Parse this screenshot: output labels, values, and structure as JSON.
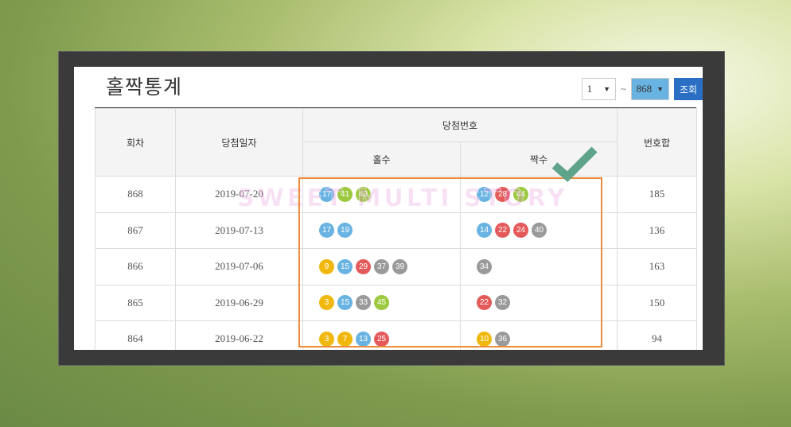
{
  "title": "홀짝통계",
  "controls": {
    "from_value": "1",
    "to_value": "868",
    "tilde": "~",
    "search_label": "조회"
  },
  "headers": {
    "round": "회차",
    "date": "당첨일자",
    "numbers": "당첨번호",
    "odd": "홀수",
    "even": "짝수",
    "sum": "번호합"
  },
  "watermark": "SWEET MULTI STORY",
  "colors": {
    "yellow": "#f0b80d",
    "blue": "#69b3e2",
    "red": "#e45a5a",
    "gray": "#9a9a9a",
    "green": "#9cc93f",
    "accent": "#2a6fc4",
    "highlight": "#ef8a3a",
    "check": "#5fa48a"
  },
  "rows": [
    {
      "round": "868",
      "date": "2019-07-20",
      "odd": [
        "17",
        "41",
        "43"
      ],
      "odd_c": [
        "b",
        "gr",
        "gr"
      ],
      "even": [
        "12",
        "28",
        "44"
      ],
      "even_c": [
        "b",
        "r",
        "gr"
      ],
      "sum": "185"
    },
    {
      "round": "867",
      "date": "2019-07-13",
      "odd": [
        "17",
        "19"
      ],
      "odd_c": [
        "b",
        "b"
      ],
      "even": [
        "14",
        "22",
        "24",
        "40"
      ],
      "even_c": [
        "b",
        "r",
        "r",
        "g"
      ],
      "sum": "136"
    },
    {
      "round": "866",
      "date": "2019-07-06",
      "odd": [
        "9",
        "15",
        "29",
        "37",
        "39"
      ],
      "odd_c": [
        "y",
        "b",
        "r",
        "g",
        "g"
      ],
      "even": [
        "34"
      ],
      "even_c": [
        "g"
      ],
      "sum": "163"
    },
    {
      "round": "865",
      "date": "2019-06-29",
      "odd": [
        "3",
        "15",
        "33",
        "45"
      ],
      "odd_c": [
        "y",
        "b",
        "g",
        "gr"
      ],
      "even": [
        "22",
        "32"
      ],
      "even_c": [
        "r",
        "g"
      ],
      "sum": "150"
    },
    {
      "round": "864",
      "date": "2019-06-22",
      "odd": [
        "3",
        "7",
        "13",
        "25"
      ],
      "odd_c": [
        "y",
        "y",
        "b",
        "r"
      ],
      "even": [
        "10",
        "36"
      ],
      "even_c": [
        "y",
        "g"
      ],
      "sum": "94"
    }
  ]
}
